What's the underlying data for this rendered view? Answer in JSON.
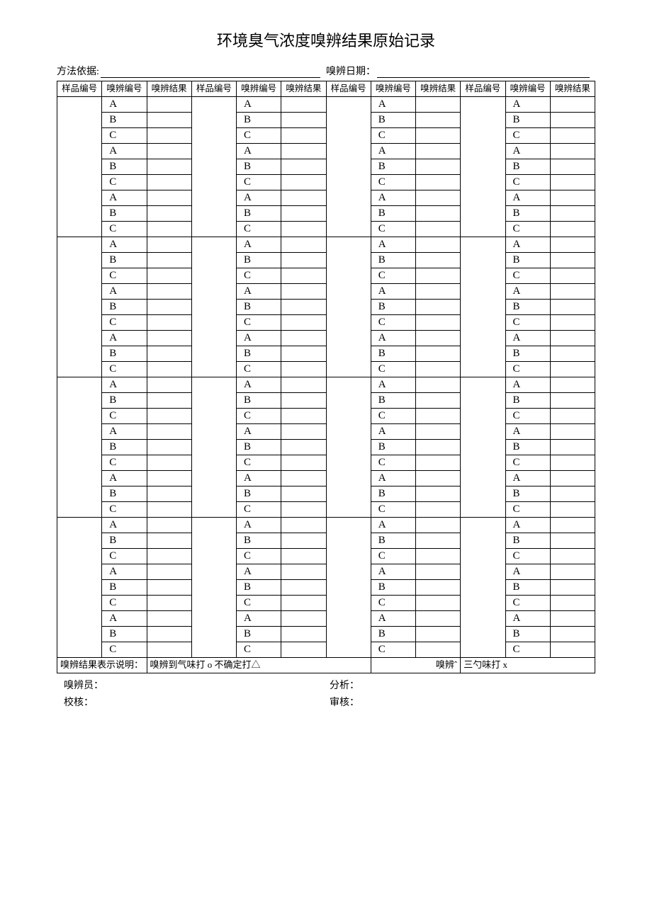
{
  "title": "环境臭气浓度嗅辨结果原始记录",
  "meta": {
    "method_label": "方法依据:",
    "method_value": "",
    "date_label": "嗅辨日期：",
    "date_value": ""
  },
  "headers": {
    "sample_no": "样品编号",
    "sniff_no": "嗅辨编号",
    "sniff_result": "嗅辨结果"
  },
  "abc": [
    "A",
    "B",
    "C"
  ],
  "note": {
    "label": "嗅辨结果表示说明：",
    "part1": "嗅辨到气味打 o 不确定打△",
    "part2": "嗅辨ˆ",
    "part3": "三勺味打 x"
  },
  "footer": {
    "sniffer": "嗅辨员：",
    "analysis": "分析：",
    "check": "校核：",
    "review": "审核："
  }
}
